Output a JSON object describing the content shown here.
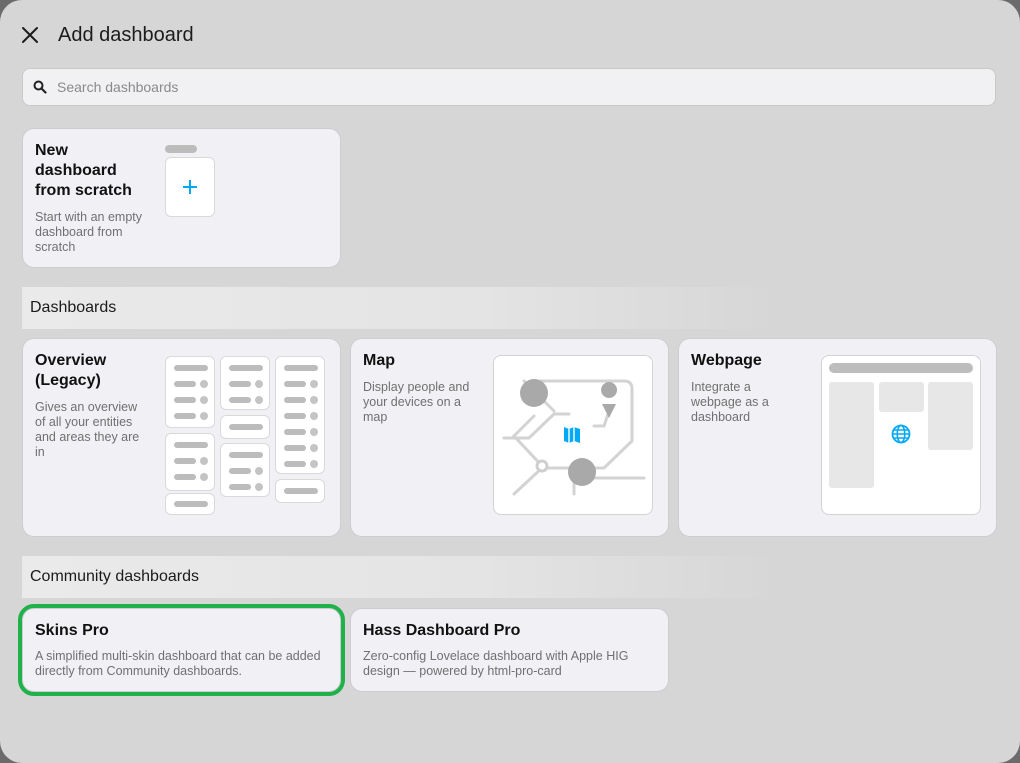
{
  "dialog": {
    "title": "Add dashboard",
    "close_icon": "close-icon"
  },
  "search": {
    "placeholder": "Search dashboards",
    "value": "",
    "icon": "search-icon"
  },
  "new_card": {
    "name": "New dashboard from scratch",
    "description": "Start with an empty dashboard from scratch",
    "icon": "plus-icon"
  },
  "sections": {
    "dashboards": "Dashboards",
    "community": "Community dashboards"
  },
  "dashboards": [
    {
      "name": "Overview (Legacy)",
      "description": "Gives an overview of all your entities and areas they are in"
    },
    {
      "name": "Map",
      "description": "Display people and your devices on a map",
      "icon": "map-icon"
    },
    {
      "name": "Webpage",
      "description": "Integrate a webpage as a dashboard",
      "icon": "globe-icon"
    }
  ],
  "community": [
    {
      "name": "Skins Pro",
      "description": "A simplified multi-skin dashboard that can be added directly from Community dashboards.",
      "selected": true
    },
    {
      "name": "Hass Dashboard Pro",
      "description": "Zero-config Lovelace dashboard with Apple HIG design — powered by html-pro-card"
    }
  ],
  "colors": {
    "accent": "#03a9f4",
    "selection": "#1fb14a",
    "card": "#f1f1f5",
    "dialog": "#d6d6d6"
  }
}
